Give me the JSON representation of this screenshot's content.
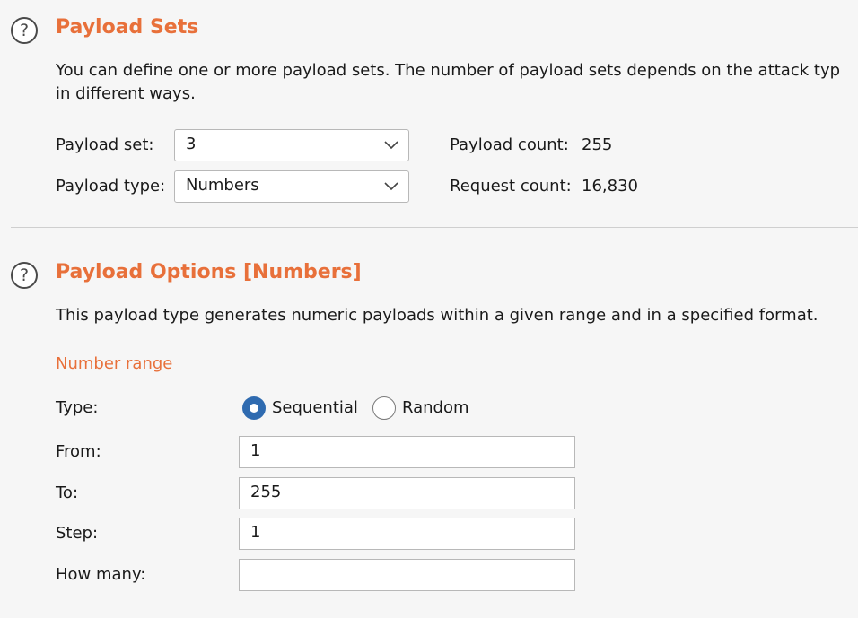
{
  "payload_sets": {
    "title": "Payload Sets",
    "description_line1": "You can define one or more payload sets. The number of payload sets depends on the attack typ",
    "description_line2": "in different ways.",
    "set_label": "Payload set:",
    "set_value": "3",
    "type_label": "Payload type:",
    "type_value": "Numbers",
    "payload_count_label": "Payload count:",
    "payload_count_value": "255",
    "request_count_label": "Request count:",
    "request_count_value": "16,830"
  },
  "payload_options": {
    "title": "Payload Options [Numbers]",
    "description": "This payload type generates numeric payloads within a given range and in a specified format.",
    "number_range_heading": "Number range",
    "type_label": "Type:",
    "radio_sequential": "Sequential",
    "radio_random": "Random",
    "selected": "Sequential",
    "from_label": "From:",
    "from_value": "1",
    "to_label": "To:",
    "to_value": "255",
    "step_label": "Step:",
    "step_value": "1",
    "how_many_label": "How many:",
    "how_many_value": ""
  },
  "colors": {
    "accent": "#e8703a",
    "radio_selected": "#2f6bb0",
    "background": "#f6f6f6"
  },
  "icons": [
    "help-icon",
    "chevron-down-icon"
  ]
}
